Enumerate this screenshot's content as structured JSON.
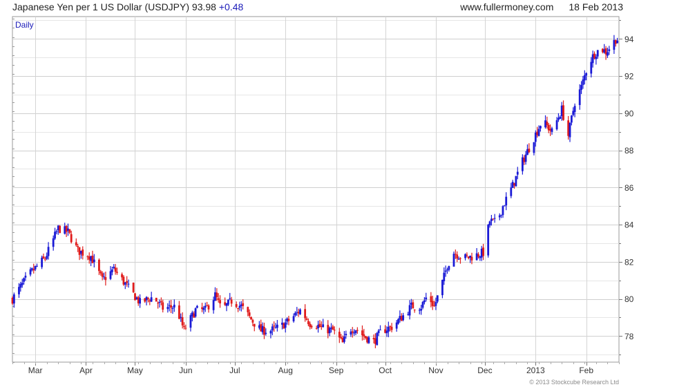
{
  "header": {
    "title": "Japanese Yen per 1 US Dollar (USDJPY)",
    "last": "93.98",
    "change": "+0.48",
    "site": "www.fullermoney.com",
    "date": "18 Feb 2013"
  },
  "footer": {
    "copyright": "© 2013 Stockcube Research Ltd"
  },
  "chart_data": {
    "type": "candlestick",
    "timeframe_label": "Daily",
    "title": "Japanese Yen per 1 US Dollar (USDJPY)",
    "ylim": [
      76.6,
      95.2
    ],
    "y_ticks": [
      78,
      80,
      82,
      84,
      86,
      88,
      90,
      92,
      94
    ],
    "x_tick_labels": [
      {
        "label": "Mar",
        "day": 14
      },
      {
        "label": "Apr",
        "day": 45
      },
      {
        "label": "May",
        "day": 75
      },
      {
        "label": "Jun",
        "day": 106
      },
      {
        "label": "Jul",
        "day": 136
      },
      {
        "label": "Aug",
        "day": 167
      },
      {
        "label": "Sep",
        "day": 198
      },
      {
        "label": "Oct",
        "day": 228
      },
      {
        "label": "Nov",
        "day": 259
      },
      {
        "label": "Dec",
        "day": 289
      },
      {
        "label": "2013",
        "day": 320
      },
      {
        "label": "Feb",
        "day": 351
      }
    ],
    "x_range_days": [
      0,
      371
    ],
    "grid": true,
    "up_color": "#1a1ad6",
    "down_color": "#e01b1b",
    "price_path_days": [
      0,
      10,
      20,
      28,
      34,
      40,
      48,
      55,
      62,
      70,
      78,
      86,
      92,
      100,
      105,
      112,
      118,
      124,
      128,
      134,
      140,
      146,
      152,
      158,
      164,
      170,
      176,
      182,
      186,
      190,
      196,
      202,
      206,
      210,
      215,
      221,
      226,
      232,
      238,
      244,
      250,
      254,
      258,
      262,
      266,
      270,
      276,
      282,
      288,
      292,
      296,
      300,
      306,
      312,
      318,
      324,
      330,
      336,
      340,
      344,
      348,
      352,
      356,
      360,
      363,
      366,
      369
    ],
    "price_path_values": [
      80.0,
      81.3,
      82.2,
      83.8,
      83.6,
      82.6,
      82.3,
      81.0,
      81.6,
      80.7,
      79.8,
      80.1,
      79.5,
      79.6,
      78.3,
      79.4,
      79.4,
      80.2,
      79.4,
      79.9,
      79.6,
      78.9,
      78.3,
      78.3,
      78.5,
      78.9,
      79.4,
      78.7,
      78.6,
      78.4,
      78.3,
      77.6,
      78.4,
      78.4,
      78.0,
      77.7,
      78.3,
      78.5,
      79.0,
      79.6,
      79.6,
      80.2,
      79.6,
      80.6,
      81.8,
      82.5,
      82.2,
      82.3,
      82.5,
      84.2,
      84.1,
      85.0,
      86.1,
      87.4,
      88.5,
      89.6,
      89.0,
      90.2,
      88.8,
      90.6,
      91.4,
      92.6,
      93.2,
      93.5,
      93.3,
      93.6,
      93.98
    ]
  }
}
